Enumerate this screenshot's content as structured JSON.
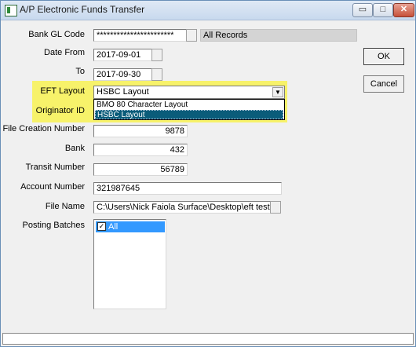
{
  "window": {
    "title": "A/P Electronic Funds Transfer",
    "controls": {
      "minimize": "▭",
      "maximize": "□",
      "close": "✕"
    }
  },
  "form": {
    "bank_gl_code": {
      "label": "Bank GL Code",
      "value": "***********************",
      "scope": "All Records"
    },
    "date_from": {
      "label": "Date From",
      "value": "2017-09-01"
    },
    "date_to": {
      "label": "To",
      "value": "2017-09-30"
    },
    "eft_layout": {
      "label": "EFT Layout",
      "value": "HSBC Layout",
      "options": [
        "BMO 80 Character Layout",
        "HSBC Layout"
      ],
      "selected_index": 1
    },
    "originator_id": {
      "label": "Originator ID"
    },
    "file_creation_number": {
      "label": "File Creation Number",
      "value": "9878"
    },
    "bank": {
      "label": "Bank",
      "value": "432"
    },
    "transit_number": {
      "label": "Transit Number",
      "value": "56789"
    },
    "account_number": {
      "label": "Account Number",
      "value": "321987645"
    },
    "file_name": {
      "label": "File Name",
      "value": "C:\\Users\\Nick Faiola Surface\\Desktop\\eft test file.t"
    },
    "posting_batches": {
      "label": "Posting Batches",
      "items": [
        {
          "label": "All",
          "checked": true
        }
      ]
    }
  },
  "buttons": {
    "ok": "OK",
    "cancel": "Cancel"
  },
  "icons": {
    "dropdown": "chevron-down-icon",
    "check": "checkmark-icon"
  },
  "colors": {
    "highlight": "#f7f26a",
    "selection": "#3399ff",
    "dropdown_selected": "#0a5c7a"
  }
}
